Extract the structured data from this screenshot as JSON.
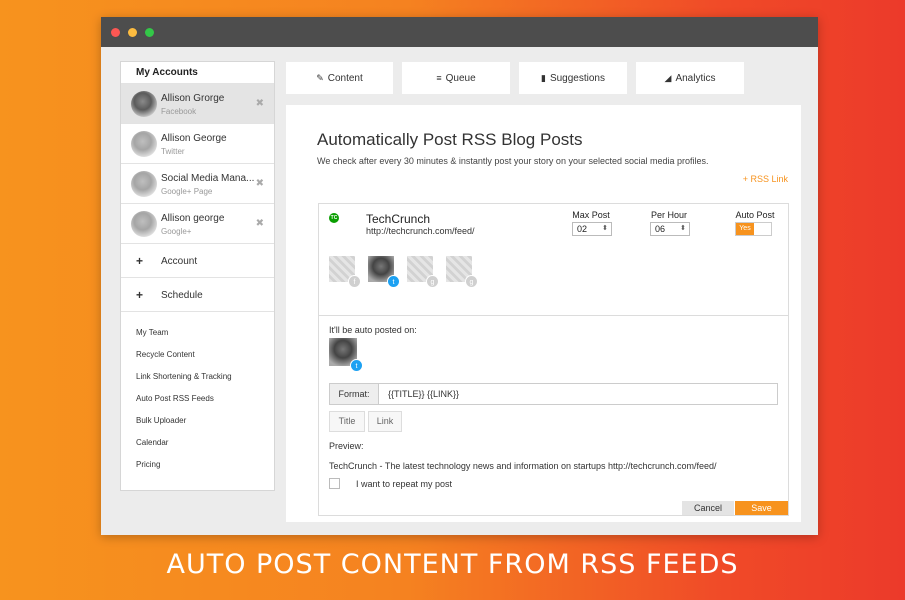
{
  "sidebar": {
    "header": "My Accounts",
    "accounts": [
      {
        "name": "Allison Grorge",
        "type": "Facebook",
        "close": "✖"
      },
      {
        "name": "Allison George",
        "type": "Twitter",
        "close": ""
      },
      {
        "name": "Social Media Mana...",
        "type": "Google+ Page",
        "close": "✖"
      },
      {
        "name": "Allison george",
        "type": "Google+",
        "close": "✖"
      }
    ],
    "actions": [
      {
        "label": "Account"
      },
      {
        "label": "Schedule"
      }
    ],
    "links": [
      "My Team",
      "Recycle Content",
      "Link Shortening & Tracking",
      "Auto Post RSS Feeds",
      "Bulk Uploader",
      "Calendar",
      "Pricing"
    ]
  },
  "tabs": [
    {
      "label": "Content",
      "icon": "✎"
    },
    {
      "label": "Queue",
      "icon": "≡"
    },
    {
      "label": "Suggestions",
      "icon": "▮"
    },
    {
      "label": "Analytics",
      "icon": "◢"
    }
  ],
  "panel": {
    "title": "Automatically Post RSS Blog Posts",
    "subtitle": "We check after every 30 minutes & instantly post your story on your selected social media profiles.",
    "rss_link": "+ RSS Link",
    "feed": {
      "logo": "TC",
      "name": "TechCrunch",
      "url": "http://techcrunch.com/feed/",
      "max_post_label": "Max Post",
      "max_post_value": "02",
      "per_hour_label": "Per Hour",
      "per_hour_value": "06",
      "auto_post_label": "Auto Post",
      "auto_post_value": "Yes",
      "profiles": [
        {
          "icon": "facebook-icon",
          "glyph": "f"
        },
        {
          "icon": "twitter-icon",
          "glyph": "t"
        },
        {
          "icon": "google-plus-icon",
          "glyph": "g"
        },
        {
          "icon": "google-plus-icon",
          "glyph": "g"
        }
      ]
    },
    "posted_on_label": "It'll be auto posted on:",
    "format_label": "Format:",
    "format_value": "{{TITLE}} {{LINK}}",
    "insert_title": "Title",
    "insert_link": "Link",
    "preview_label": "Preview:",
    "preview_text": "TechCrunch - The latest technology news and information on startups http://techcrunch.com/feed/",
    "repeat_label": "I want to repeat my post",
    "cancel_label": "Cancel",
    "save_label": "Save"
  },
  "banner": "AUTO POST CONTENT FROM RSS FEEDS",
  "colors": {
    "accent": "#f7931e",
    "twitter": "#1da1f2",
    "titlebar": "#4d4d4d"
  }
}
